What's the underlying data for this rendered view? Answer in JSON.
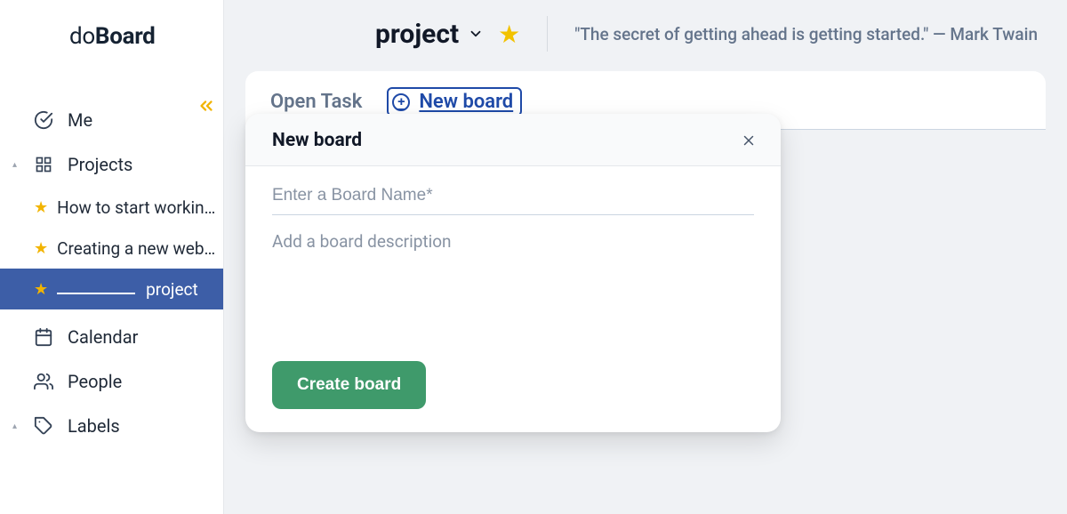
{
  "brand": {
    "do": "do",
    "board": "Board"
  },
  "sidebar": {
    "me": "Me",
    "projects": "Projects",
    "items": [
      {
        "label": "How to start workin…"
      },
      {
        "label": "Creating a new web…"
      },
      {
        "label": "project"
      }
    ],
    "calendar": "Calendar",
    "people": "People",
    "labels": "Labels"
  },
  "header": {
    "project_title": "project",
    "quote": "\"The secret of getting ahead is getting started.\" — Mark Twain"
  },
  "tabs": {
    "open_task": "Open Task",
    "new_board": "New board"
  },
  "modal": {
    "title": "New board",
    "name_placeholder": "Enter a Board Name*",
    "desc_placeholder": "Add a board description",
    "create_label": "Create board"
  }
}
